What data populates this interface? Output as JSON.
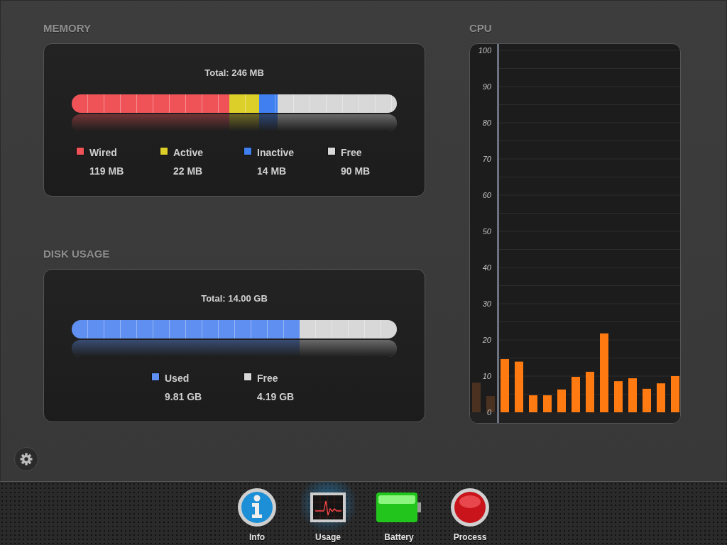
{
  "memory": {
    "heading": "MEMORY",
    "total": "Total: 246 MB",
    "segments": [
      {
        "label": "Wired",
        "value": "119 MB",
        "color": "#ef5358"
      },
      {
        "label": "Active",
        "value": "22 MB",
        "color": "#ddcf2a"
      },
      {
        "label": "Inactive",
        "value": "14 MB",
        "color": "#3f7ff0"
      },
      {
        "label": "Free",
        "value": "90 MB",
        "color": "#d8d8d8"
      }
    ]
  },
  "disk": {
    "heading": "DISK USAGE",
    "total": "Total: 14.00 GB",
    "segments": [
      {
        "label": "Used",
        "value": "9.81 GB",
        "color": "#5f8ff0"
      },
      {
        "label": "Free",
        "value": "4.19 GB",
        "color": "#d8d8d8"
      }
    ]
  },
  "cpu": {
    "heading": "CPU",
    "chart_data": {
      "type": "bar",
      "grid": true,
      "ylim": [
        0,
        100
      ],
      "yticks": [
        0,
        10,
        20,
        30,
        40,
        50,
        60,
        70,
        80,
        90,
        100
      ],
      "series": [
        {
          "color": "#ff7a10",
          "values": [
            14.7,
            14,
            4.7,
            4.7,
            6.3,
            9.8,
            11.2,
            21.8,
            8.6,
            9.4,
            6.5,
            8,
            10
          ]
        }
      ]
    }
  },
  "tabs": [
    {
      "label": "Info",
      "kind": "info",
      "selected": false
    },
    {
      "label": "Usage",
      "kind": "usage",
      "selected": true
    },
    {
      "label": "Battery",
      "kind": "battery",
      "selected": false
    },
    {
      "label": "Process",
      "kind": "process",
      "selected": false
    }
  ]
}
